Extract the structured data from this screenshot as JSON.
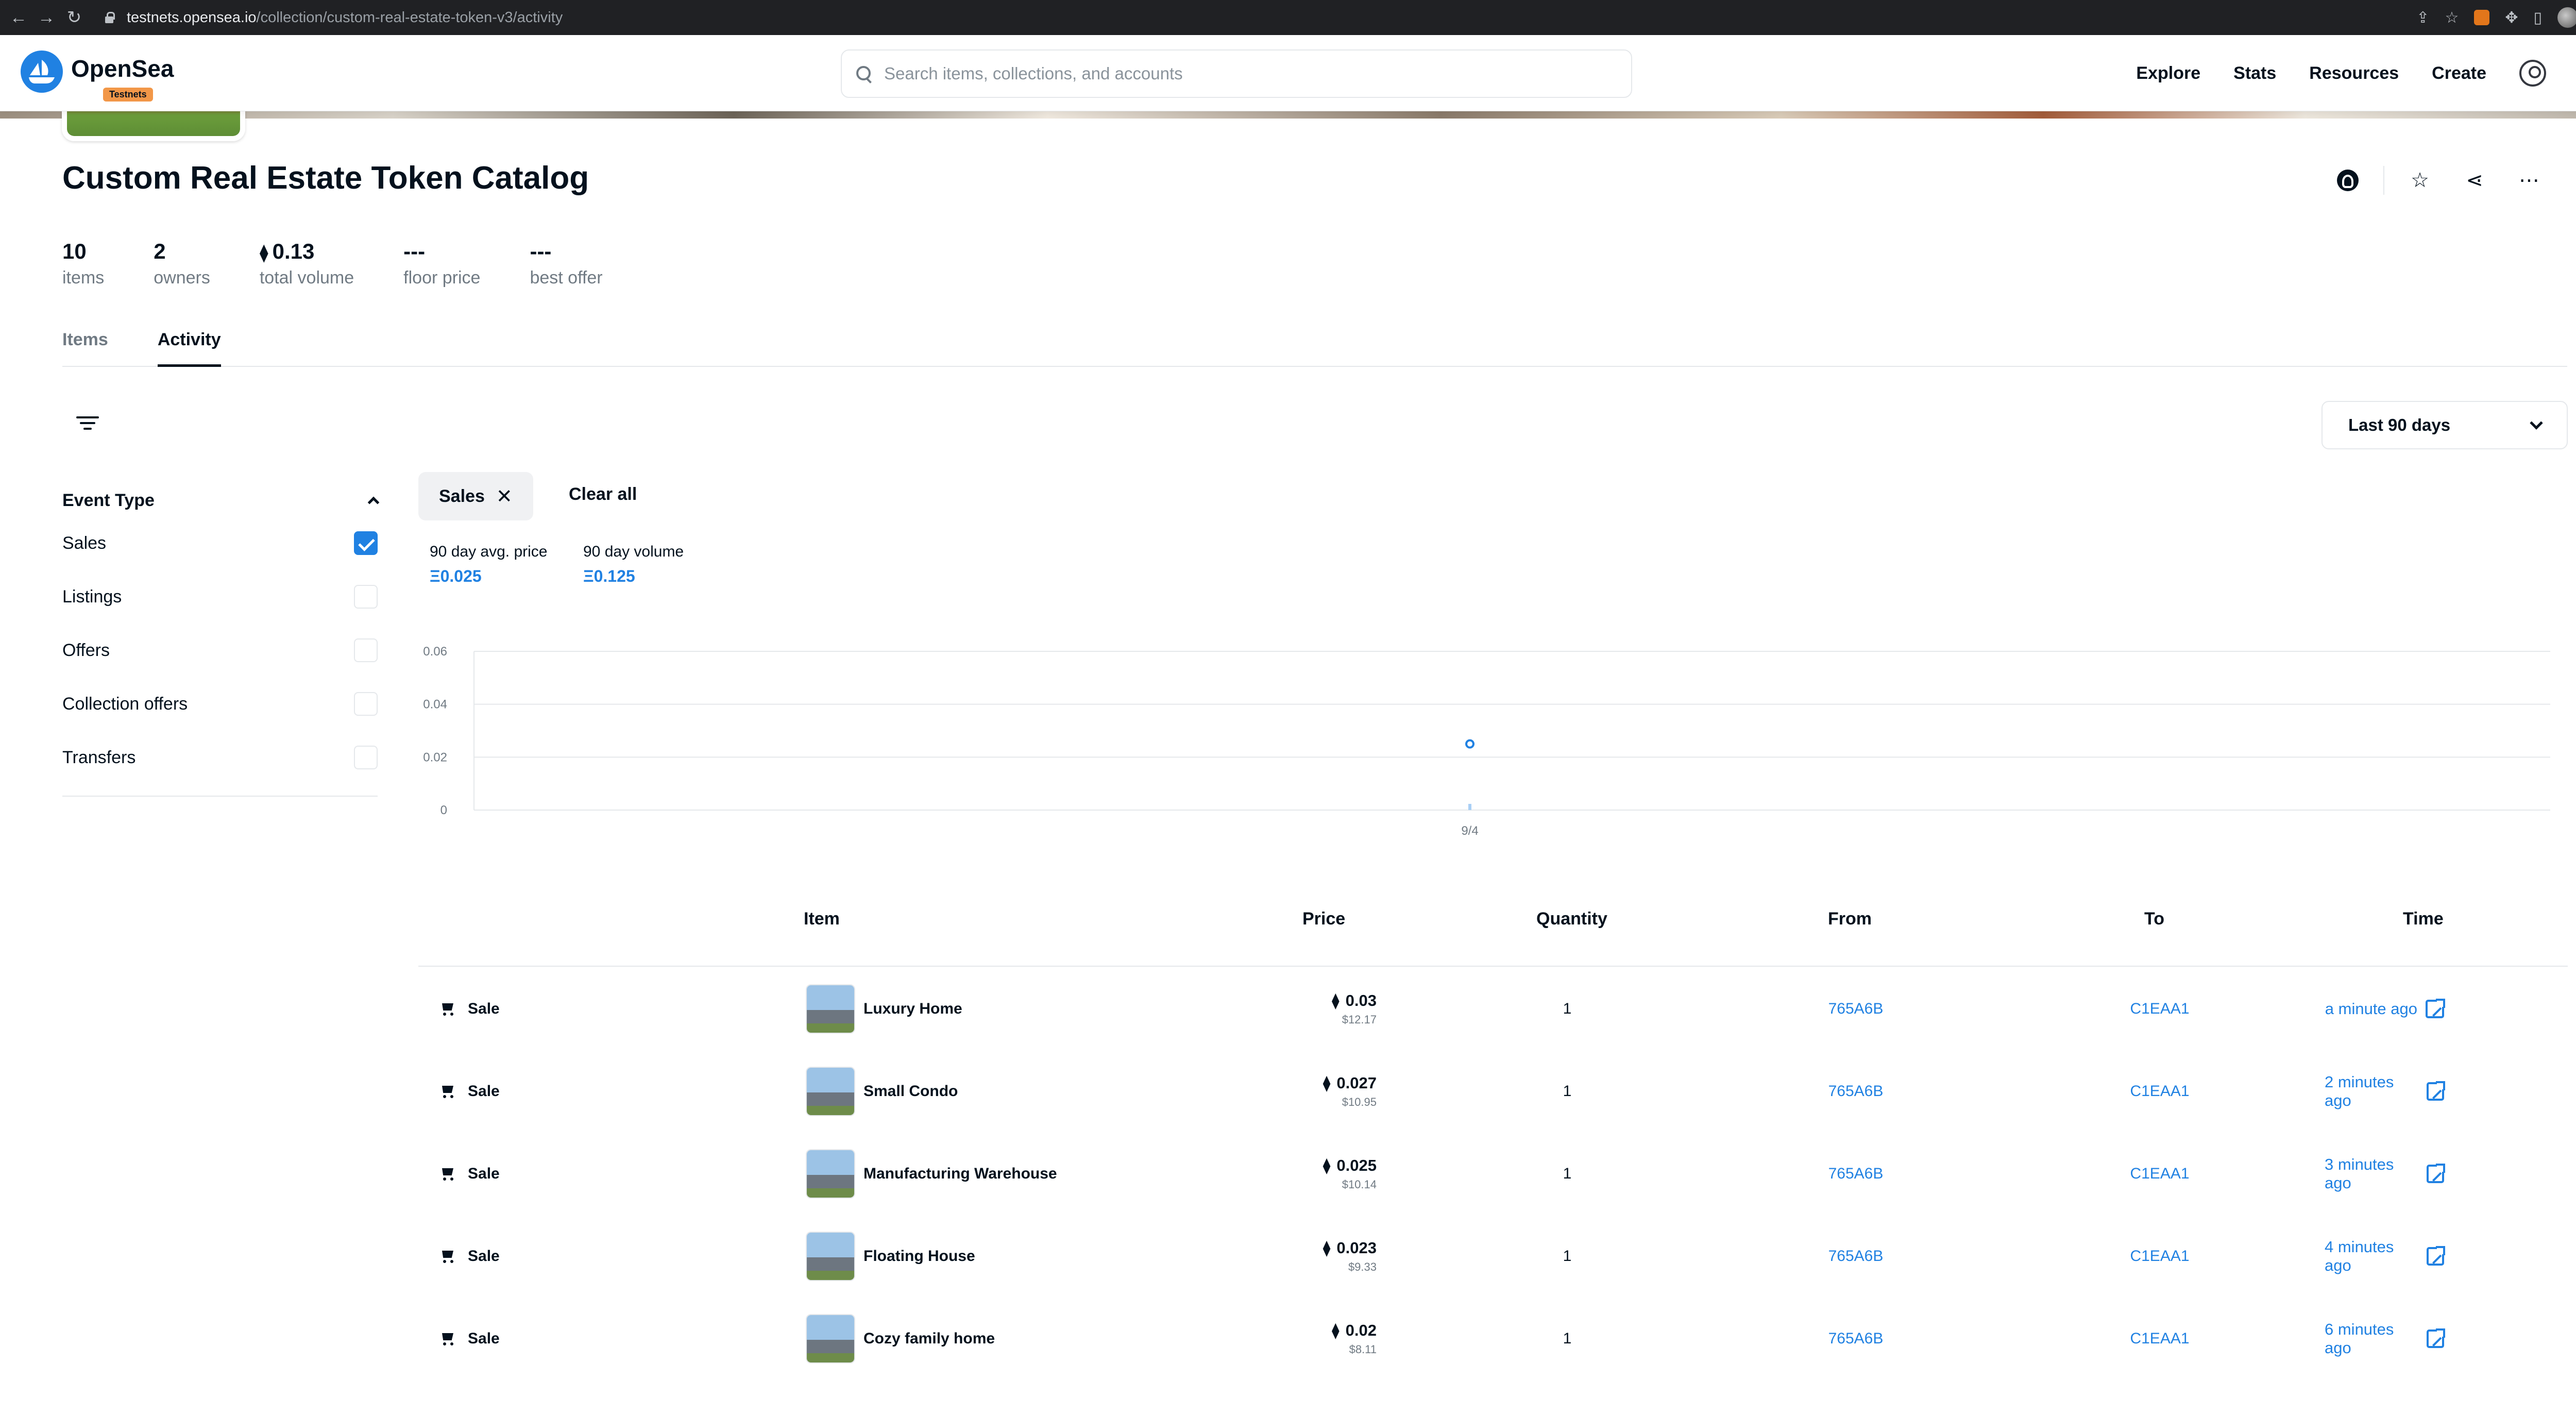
{
  "browser": {
    "url_host": "testnets.opensea.io",
    "url_path": "/collection/custom-real-estate-token-v3/activity"
  },
  "header": {
    "logo_text": "OpenSea",
    "badge": "Testnets",
    "search_placeholder": "Search items, collections, and accounts",
    "nav": [
      "Explore",
      "Stats",
      "Resources",
      "Create"
    ]
  },
  "collection": {
    "title": "Custom Real Estate Token Catalog",
    "stats": [
      {
        "value": "10",
        "label": "items"
      },
      {
        "value": "2",
        "label": "owners"
      },
      {
        "value": "0.13",
        "label": "total volume",
        "eth": true
      },
      {
        "value": "---",
        "label": "floor price"
      },
      {
        "value": "---",
        "label": "best offer"
      }
    ]
  },
  "tabs": [
    {
      "label": "Items",
      "active": false
    },
    {
      "label": "Activity",
      "active": true
    }
  ],
  "time_range": "Last 90 days",
  "filters": {
    "heading": "Event Type",
    "items": [
      {
        "label": "Sales",
        "checked": true
      },
      {
        "label": "Listings",
        "checked": false
      },
      {
        "label": "Offers",
        "checked": false
      },
      {
        "label": "Collection offers",
        "checked": false
      },
      {
        "label": "Transfers",
        "checked": false
      }
    ]
  },
  "active_chip": "Sales",
  "clear_all": "Clear all",
  "kpis": {
    "avg_label": "90 day avg. price",
    "avg_value": "Ξ0.025",
    "vol_label": "90 day volume",
    "vol_value": "Ξ0.125"
  },
  "chart_data": {
    "type": "scatter",
    "x_tick_labels": [
      "9/4"
    ],
    "y_tick_labels": [
      "0",
      "0.02",
      "0.04",
      "0.06"
    ],
    "ylim": [
      0,
      0.06
    ],
    "points": [
      {
        "x": "9/4",
        "y": 0.025
      }
    ],
    "grid": true
  },
  "table": {
    "headers": [
      "Item",
      "Price",
      "Quantity",
      "From",
      "To",
      "Time"
    ],
    "rows": [
      {
        "event": "Sale",
        "item": "Luxury Home",
        "price": "0.03",
        "usd": "$12.17",
        "qty": "1",
        "from": "765A6B",
        "to": "C1EAA1",
        "time": "a minute ago"
      },
      {
        "event": "Sale",
        "item": "Small Condo",
        "price": "0.027",
        "usd": "$10.95",
        "qty": "1",
        "from": "765A6B",
        "to": "C1EAA1",
        "time": "2 minutes ago"
      },
      {
        "event": "Sale",
        "item": "Manufacturing Warehouse",
        "price": "0.025",
        "usd": "$10.14",
        "qty": "1",
        "from": "765A6B",
        "to": "C1EAA1",
        "time": "3 minutes ago"
      },
      {
        "event": "Sale",
        "item": "Floating House",
        "price": "0.023",
        "usd": "$9.33",
        "qty": "1",
        "from": "765A6B",
        "to": "C1EAA1",
        "time": "4 minutes ago"
      },
      {
        "event": "Sale",
        "item": "Cozy family home",
        "price": "0.02",
        "usd": "$8.11",
        "qty": "1",
        "from": "765A6B",
        "to": "C1EAA1",
        "time": "6 minutes ago"
      }
    ]
  }
}
